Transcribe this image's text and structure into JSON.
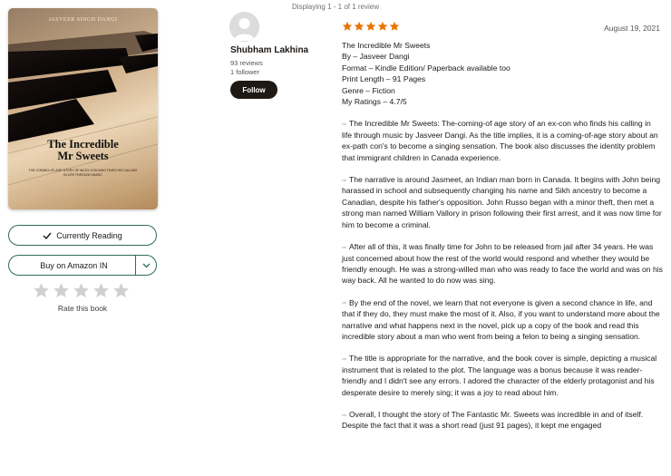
{
  "status": {
    "displaying": "Displaying 1 - 1 of 1 review"
  },
  "book": {
    "cover_author": "JASVEER SINGH DANGI",
    "cover_title_line1": "The Incredible",
    "cover_title_line2": "Mr Sweets",
    "cover_tagline": "THE COMING-OF-AGE STORY OF AN EX-CON WHO FINDS HIS CALLING IN LIFE THROUGH MUSIC"
  },
  "actions": {
    "shelf_label": "Currently Reading",
    "buy_label": "Buy on Amazon IN",
    "rate_label": "Rate this book",
    "user_rating": 0
  },
  "reviewer": {
    "name": "Shubham Lakhina",
    "reviews": "93 reviews",
    "followers": "1 follower",
    "follow_label": "Follow"
  },
  "review": {
    "rating": 5,
    "star_color": "#e87400",
    "date": "August 19, 2021",
    "meta": [
      "The Incredible Mr Sweets",
      "By – Jasveer Dangi",
      "Format – Kindle Edition/ Paperback available too",
      "Print Length – 91 Pages",
      "Genre – Fiction",
      "My Ratings – 4.7/5"
    ],
    "paragraphs": [
      "The Incredible Mr Sweets: The-coming-of age story of an ex-con who finds his calling in life through music by Jasveer Dangi. As the title implies, it is a coming-of-age story about an ex-path con's to become a singing sensation. The book also discusses the identity problem that immigrant children in Canada experience.",
      "The narrative is around Jasmeet, an Indian man born in Canada. It begins with John being harassed in school and subsequently changing his name and Sikh ancestry to become a Canadian, despite his father's opposition. John Russo began with a minor theft, then met a strong man named William Vallory in prison following their first arrest, and it was now time for him to become a criminal.",
      "After all of this, it was finally time for John to be released from jail after 34 years. He was just concerned about how the rest of the world would respond and whether they would be friendly enough. He was a strong-willed man who was ready to face the world and was on his way back. All he wanted to do now was sing.",
      "By the end of the novel, we learn that not everyone is given a second chance in life, and that if they do, they must make the most of it. Also, if you want to understand more about the narrative and what happens next in the novel, pick up a copy of the book and read this incredible story about a man who went from being a felon to being a singing sensation.",
      "The title is appropriate for the narrative, and the book cover is simple, depicting a musical instrument that is related to the plot. The language was a bonus because it was reader-friendly and I didn't see any errors. I adored the character of the elderly protagonist and his desperate desire to merely sing; it was a joy to read about him.",
      "Overall, I thought the story of The Fantastic Mr. Sweets was incredible in and of itself. Despite the fact that it was a short read (just 91 pages), it kept me engaged"
    ]
  }
}
